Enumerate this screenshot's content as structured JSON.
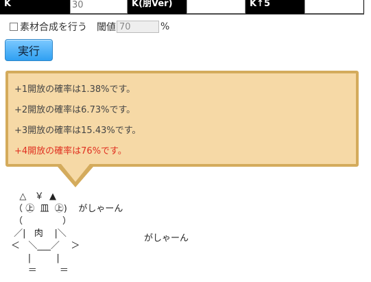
{
  "table": {
    "cells": [
      {
        "kind": "label",
        "text": "K"
      },
      {
        "kind": "value",
        "text": "30"
      },
      {
        "kind": "label",
        "text": "K(朋Ver)"
      },
      {
        "kind": "value",
        "text": ""
      },
      {
        "kind": "label",
        "text": "K↑5"
      },
      {
        "kind": "value",
        "text": ""
      }
    ]
  },
  "options": {
    "material_label": "素材合成を行う",
    "threshold_label": "閾値",
    "threshold_value": "70",
    "threshold_unit": "%"
  },
  "run_button": {
    "label": "実行"
  },
  "results": [
    {
      "text": "+1開放の確率は1.38%です。",
      "highlight": false
    },
    {
      "text": "+2開放の確率は6.73%です。",
      "highlight": false
    },
    {
      "text": "+3開放の確率は15.43%です。",
      "highlight": false
    },
    {
      "text": "+4開放の確率は76%です。",
      "highlight": true
    }
  ],
  "ascii_art": "   △   ￥  ▲\n （ ㊤  皿  ㊤)    がしゃーん\n （              ）\n ／|   肉    |＼\n＜   ＼___／    ＞\n      |         |\n      ＝        ＝",
  "gasha_text": "がしゃーん",
  "colors": {
    "callout_bg": "#f6d9a6",
    "callout_border": "#d4ab5c",
    "highlight_text": "#e03020",
    "button_top": "#7cc9ff",
    "button_bottom": "#2fa0f2"
  }
}
